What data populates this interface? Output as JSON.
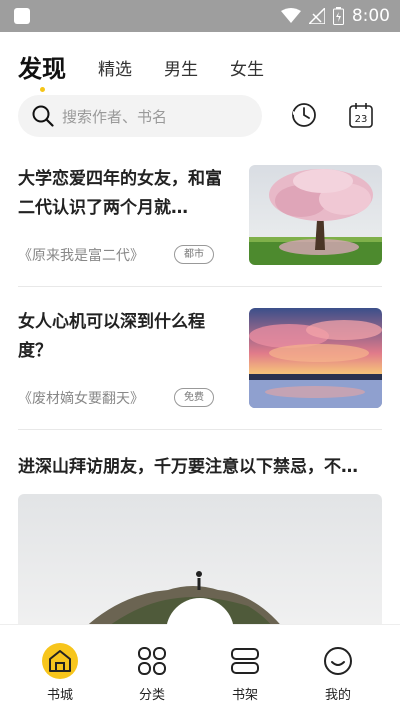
{
  "status_bar": {
    "time": "8:00"
  },
  "tabs": [
    {
      "label": "发现",
      "active": true
    },
    {
      "label": "精选",
      "active": false
    },
    {
      "label": "男生",
      "active": false
    },
    {
      "label": "女生",
      "active": false
    }
  ],
  "search": {
    "placeholder": "搜索作者、书名"
  },
  "calendar": {
    "day": "23"
  },
  "articles": [
    {
      "title": "大学恋爱四年的女友，和富二代认识了两个月就…",
      "source": "《原来我是富二代》",
      "tag": "都市"
    },
    {
      "title": "女人心机可以深到什么程度？",
      "source": "《废材嫡女要翻天》",
      "tag": "免费"
    },
    {
      "title": "进深山拜访朋友，千万要注意以下禁忌，不…"
    }
  ],
  "bottom_nav": [
    {
      "label": "书城",
      "active": true
    },
    {
      "label": "分类",
      "active": false
    },
    {
      "label": "书架",
      "active": false
    },
    {
      "label": "我的",
      "active": false
    }
  ],
  "colors": {
    "accent": "#f7c51c",
    "status_bar": "#9e9e9e"
  }
}
